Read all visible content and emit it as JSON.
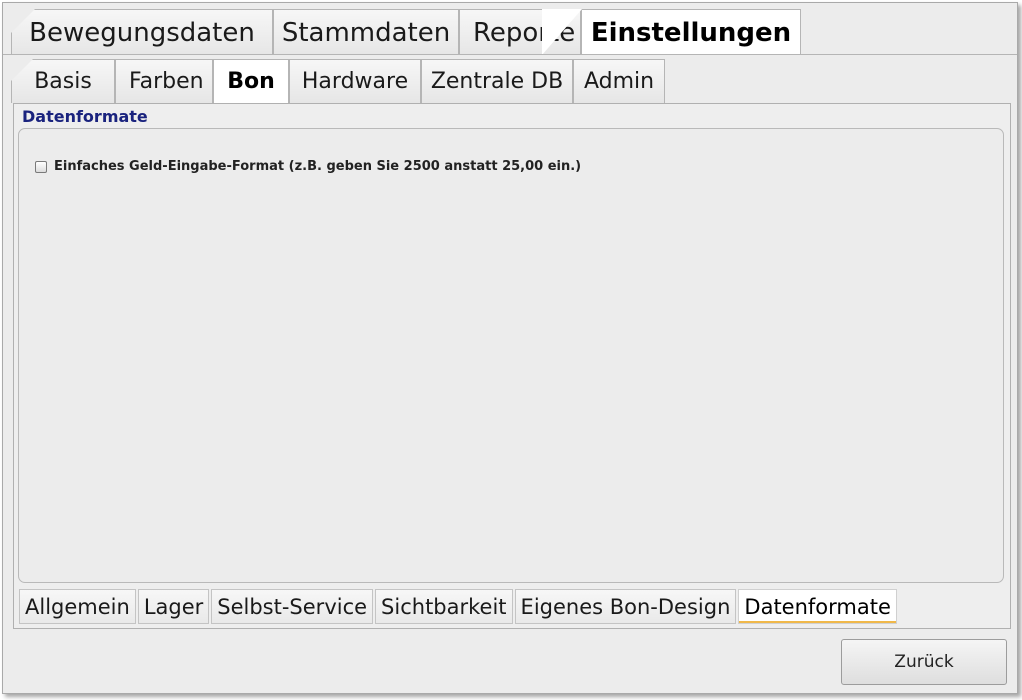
{
  "main_tabs": [
    {
      "label": "Bewegungsdaten"
    },
    {
      "label": "Stammdaten"
    },
    {
      "label": "Reporte"
    },
    {
      "label": "Einstellungen"
    }
  ],
  "sub_tabs": [
    {
      "label": "Basis"
    },
    {
      "label": "Farben"
    },
    {
      "label": "Bon"
    },
    {
      "label": "Hardware"
    },
    {
      "label": "Zentrale DB"
    },
    {
      "label": "Admin"
    }
  ],
  "panel": {
    "group_title": "Datenformate",
    "checkbox_label": "Einfaches Geld-Eingabe-Format (z.B. geben Sie 2500 anstatt 25,00 ein.)",
    "checkbox_checked": false
  },
  "bottom_tabs": [
    {
      "label": "Allgemein"
    },
    {
      "label": "Lager"
    },
    {
      "label": "Selbst-Service"
    },
    {
      "label": "Sichtbarkeit"
    },
    {
      "label": "Eigenes Bon-Design"
    },
    {
      "label": "Datenformate"
    }
  ],
  "back_button": {
    "label": "Zurück"
  },
  "colors": {
    "group_title": "#1a237e",
    "active_tab_underline": "#f0b84a"
  }
}
